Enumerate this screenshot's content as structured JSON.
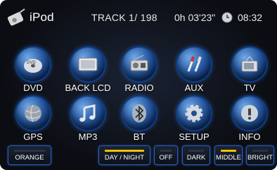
{
  "header": {
    "app_title": "iPod",
    "track": "TRACK 1/ 198",
    "elapsed": "0h 03'23\"",
    "clock": "08:32"
  },
  "menu": {
    "row1": [
      "DVD",
      "BACK LCD",
      "RADIO",
      "AUX",
      "TV"
    ],
    "row2": [
      "GPS",
      "MP3",
      "BT",
      "SETUP",
      "INFO"
    ]
  },
  "bottom": {
    "theme": "ORANGE",
    "day_night": "DAY / NIGHT",
    "off": "OFF",
    "dark": "DARK",
    "middle": "MIDDLE",
    "bright": "BRIGHT"
  },
  "colors": {
    "accent": "#f2c200",
    "orb": "#2b5da6",
    "border": "#2f5fb8"
  }
}
